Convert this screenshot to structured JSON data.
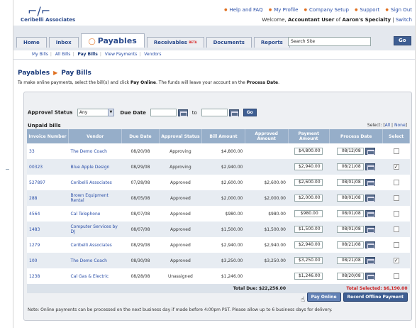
{
  "logo": {
    "glyph": "⌐/⌐",
    "name": "Ceribelli Associates"
  },
  "top_links": [
    "Help and FAQ",
    "My Profile",
    "Company Setup",
    "Support",
    "Sign Out"
  ],
  "welcome": {
    "prefix": "Welcome,",
    "user": "Accountant User",
    "of": "of",
    "company": "Aaron's Specialty",
    "sep": "|",
    "switch": "Switch"
  },
  "tabs": [
    {
      "label": "Home",
      "active": false
    },
    {
      "label": "Inbox",
      "active": false
    },
    {
      "label": "Payables",
      "active": true,
      "icon": "payables-icon"
    },
    {
      "label": "Receivables",
      "active": false,
      "badge": "BETA"
    },
    {
      "label": "Documents",
      "active": false
    },
    {
      "label": "Reports",
      "active": false
    }
  ],
  "search": {
    "value": "Search Site",
    "go": "Go"
  },
  "subnav": [
    "My Bills",
    "All Bills",
    "Pay Bills",
    "View Payments",
    "Vendors"
  ],
  "subnav_current": "Pay Bills",
  "breadcrumb": {
    "section": "Payables",
    "page": "Pay Bills"
  },
  "instructions": {
    "pre": "To make online payments, select the bill(s) and click",
    "action": "Pay Online",
    "mid": ". The funds will leave your account on the",
    "date": "Process Date",
    "post": "."
  },
  "filter": {
    "status_label": "Approval Status",
    "status_value": "Any",
    "due_label": "Due Date",
    "to": "to",
    "go": "Go"
  },
  "unpaid": {
    "title": "Unpaid bills",
    "select_prefix": "Select: [",
    "all": "All",
    "sep": "|",
    "none": "None",
    "select_suffix": "]"
  },
  "table": {
    "headers": [
      "Invoice Number",
      "Vendor",
      "Due Date",
      "Approval Status",
      "Bill Amount",
      "Approved Amount",
      "Payment Amount",
      "Process Date",
      "Select"
    ],
    "rows": [
      {
        "inv": "33",
        "vendor": "The Demo Coach",
        "due": "08/20/08",
        "status": "Approving",
        "bill": "$4,800.00",
        "approved": "",
        "payment": "$4,800.00",
        "process": "08/12/08",
        "selected": false
      },
      {
        "inv": "00323",
        "vendor": "Blue Apple Design",
        "due": "08/29/08",
        "status": "Approving",
        "bill": "$2,940.00",
        "approved": "",
        "payment": "$2,940.00",
        "process": "08/21/08",
        "selected": true
      },
      {
        "inv": "527897",
        "vendor": "Ceribelli Associates",
        "due": "07/28/08",
        "status": "Approved",
        "bill": "$2,600.00",
        "approved": "$2,600.00",
        "payment": "$2,600.00",
        "process": "08/01/08",
        "selected": false
      },
      {
        "inv": "288",
        "vendor": "Brown Equipment Rental",
        "due": "08/05/08",
        "status": "Approved",
        "bill": "$2,000.00",
        "approved": "$2,000.00",
        "payment": "$2,000.00",
        "process": "08/01/08",
        "selected": false
      },
      {
        "inv": "4564",
        "vendor": "Cal Telephone",
        "due": "08/07/08",
        "status": "Approved",
        "bill": "$980.00",
        "approved": "$980.00",
        "payment": "$980.00",
        "process": "08/01/08",
        "selected": false
      },
      {
        "inv": "1483",
        "vendor": "Computer Services by DJ",
        "due": "08/07/08",
        "status": "Approved",
        "bill": "$1,500.00",
        "approved": "$1,500.00",
        "payment": "$1,500.00",
        "process": "08/01/08",
        "selected": false
      },
      {
        "inv": "1279",
        "vendor": "Ceribelli Associates",
        "due": "08/29/08",
        "status": "Approved",
        "bill": "$2,940.00",
        "approved": "$2,940.00",
        "payment": "$2,940.00",
        "process": "08/21/08",
        "selected": false
      },
      {
        "inv": "100",
        "vendor": "The Demo Coach",
        "due": "08/30/08",
        "status": "Approved",
        "bill": "$3,250.00",
        "approved": "$3,250.00",
        "payment": "$3,250.00",
        "process": "08/21/08",
        "selected": true
      },
      {
        "inv": "1238",
        "vendor": "Cal Gas & Electric",
        "due": "08/28/08",
        "status": "Unassigned",
        "bill": "$1,246.00",
        "approved": "",
        "payment": "$1,246.00",
        "process": "08/20/08",
        "selected": false
      }
    ],
    "total_due": "Total Due: $22,256.00",
    "total_selected": "Total Selected: $6,190.00"
  },
  "buttons": {
    "pay_online": "Pay Online",
    "record_offline": "Record Offline Payment"
  },
  "note": "Note: Online payments can be processed on the next business day if made before 4:00pm PST. Please allow up to 6 business days for delivery.",
  "colors": {
    "header_blue": "#96aec9",
    "link_blue": "#2b4fa8",
    "accent_orange": "#e07020",
    "total_red": "#cc2020",
    "button_navy": "#3e5e92"
  }
}
